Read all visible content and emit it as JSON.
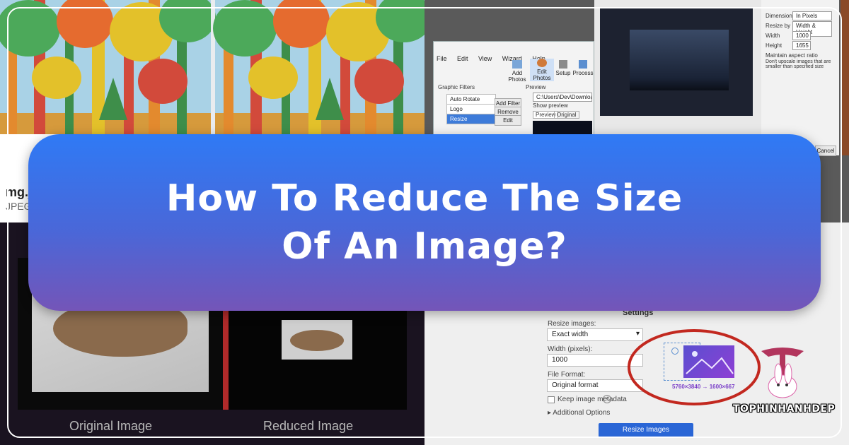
{
  "title": {
    "line1": "How To Reduce The Size",
    "line2": "Of An Image?"
  },
  "left_top": {
    "file_name": "mg.jpg",
    "file_type": "JPEG"
  },
  "photo_window": {
    "menu": [
      "File",
      "Edit",
      "View",
      "Wizard",
      "Help"
    ],
    "toolbar": [
      "Add Photos",
      "Edit Photos",
      "Setup",
      "Process"
    ],
    "filters_header": "Graphic Filters",
    "filters": [
      "Auto Rotate",
      "Logo",
      "Resize"
    ],
    "filter_buttons": [
      "Add Filter",
      "Remove",
      "Edit"
    ],
    "preview_header": "Preview",
    "preview_path": "C:\\Users\\Dev\\Downloads\\landscape",
    "show_preview": "Show preview",
    "preview_tabs": [
      "Preview",
      "Original"
    ]
  },
  "resize_dialog": {
    "dimensions_label": "Dimensions",
    "dimensions_value": "In Pixels",
    "resize_by_label": "Resize by",
    "resize_by_value": "Width & Height",
    "width_label": "Width",
    "width_value": "1000",
    "height_label": "Height",
    "height_value": "1655",
    "maintain_aspect": "Maintain aspect ratio",
    "no_upscale": "Don't upscale images that are smaller than specified size",
    "cancel": "Cancel"
  },
  "comparison": {
    "original_label": "Original Image",
    "reduced_label": "Reduced Image"
  },
  "settings_panel": {
    "heading": "Settings",
    "resize_label": "Resize images:",
    "resize_value": "Exact width",
    "width_label": "Width (pixels):",
    "width_value": "1000",
    "format_label": "File Format:",
    "format_value": "Original format",
    "keep_metadata": "Keep image metadata",
    "additional_options": "Additional Options",
    "resize_button": "Resize Images",
    "size_from": "5760×3840",
    "size_to": "1600×667",
    "arrow": "→"
  },
  "logo": {
    "text": "Tophinhanhdep"
  },
  "colors": {
    "overlay_top": "#2f7af5",
    "overlay_bottom": "#7455b8",
    "resize_button": "#2a66d6",
    "circle": "#c2281f"
  }
}
